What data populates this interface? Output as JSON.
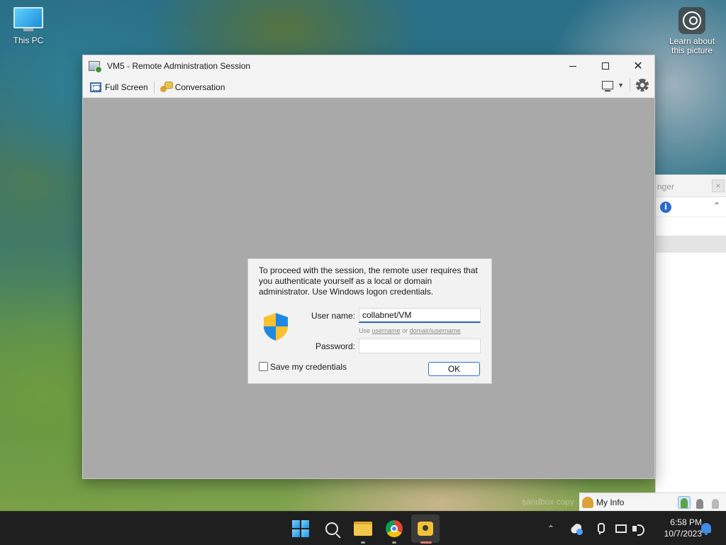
{
  "desktop": {
    "this_pc_label": "This PC",
    "learn_label": "Learn about this picture",
    "watermark": "sandbox copy"
  },
  "window": {
    "title": "VM5 - Remote Administration Session",
    "toolbar": {
      "full_screen_label": "Full Screen",
      "conversation_label": "Conversation"
    }
  },
  "dialog": {
    "message": "To proceed with the session, the remote user requires that you authenticate yourself as a local or domain administrator. Use Windows logon credentials.",
    "username_label": "User name:",
    "username_value": "collabnet/VM",
    "hint_prefix": "Use",
    "hint_username": "username",
    "hint_or": "or",
    "hint_domain": "domain\\username",
    "password_label": "Password:",
    "password_value": "",
    "save_credentials_label": "Save my credentials",
    "save_credentials_checked": false,
    "ok_label": "OK"
  },
  "messenger": {
    "header_text": "nger",
    "my_info_label": "My Info"
  },
  "taskbar": {
    "time": "6:58 PM",
    "date": "10/7/2023"
  },
  "colors": {
    "accent": "#2f6fd1",
    "content_bg": "#a9a9a9",
    "taskbar_bg": "#1f1f1f"
  }
}
